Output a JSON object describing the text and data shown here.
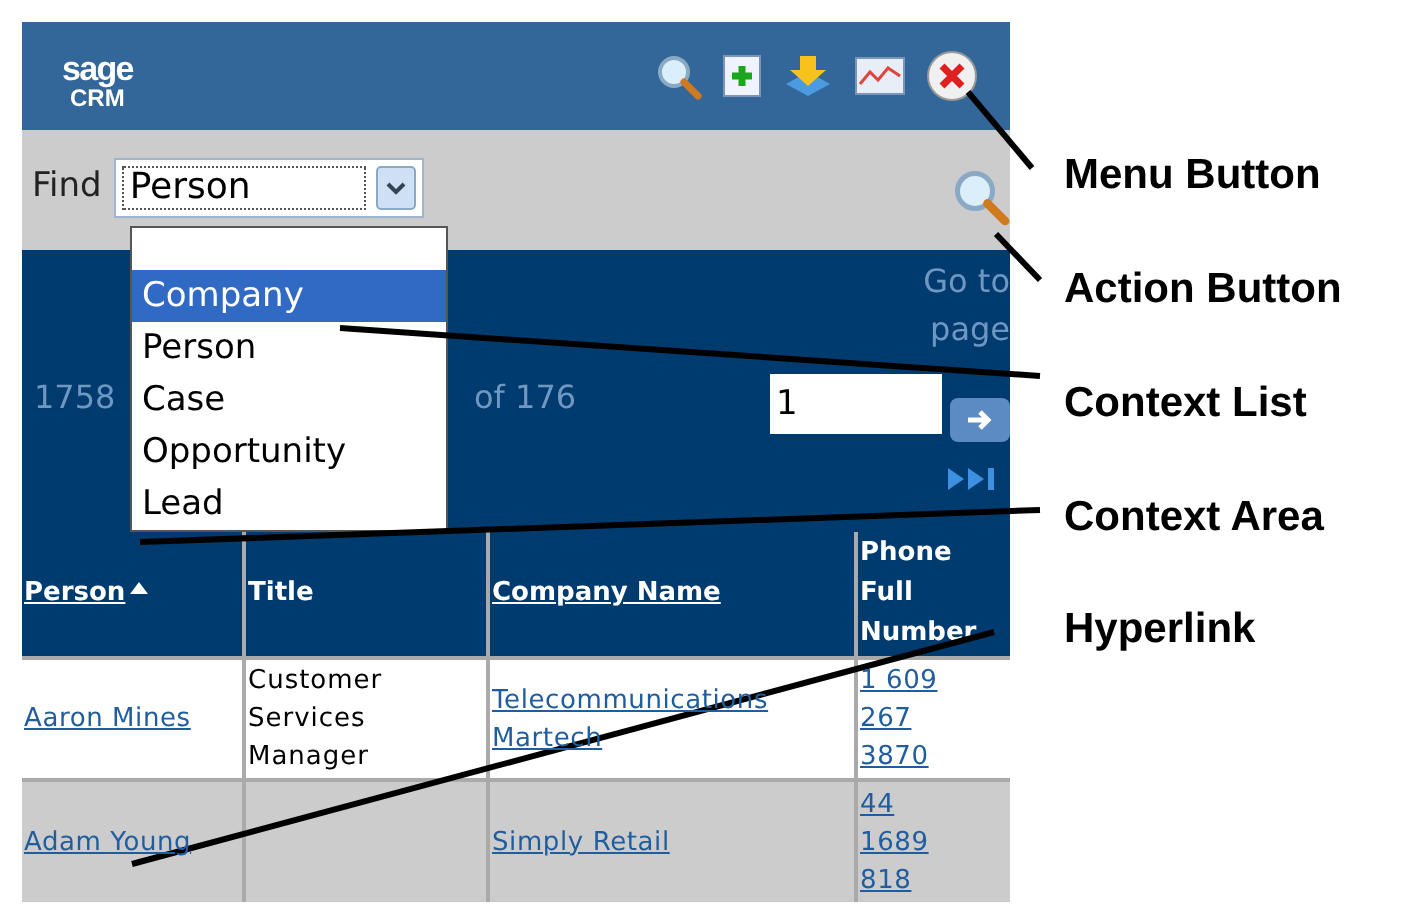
{
  "header": {
    "logo_top": "sage",
    "logo_bottom": "CRM"
  },
  "find_bar": {
    "label": "Find",
    "value": "Person"
  },
  "context_list": {
    "items": [
      {
        "label": "Company",
        "selected": true
      },
      {
        "label": "Person",
        "selected": false
      },
      {
        "label": "Case",
        "selected": false
      },
      {
        "label": "Opportunity",
        "selected": false
      },
      {
        "label": "Lead",
        "selected": false
      }
    ]
  },
  "context_area": {
    "count_text": "1758",
    "range_text": "of 176",
    "goto_label": "Go to page",
    "page_value": "1"
  },
  "table": {
    "columns": [
      {
        "label": "Person",
        "sorted": true,
        "link": true
      },
      {
        "label": "Title",
        "sorted": false,
        "link": false
      },
      {
        "label": "Company Name",
        "sorted": false,
        "link": true
      },
      {
        "label": "Phone Full Number",
        "sorted": false,
        "link": false
      }
    ],
    "rows": [
      {
        "cells": [
          {
            "kind": "link",
            "text": "Aaron Mines"
          },
          {
            "kind": "text",
            "text": "Customer Services Manager"
          },
          {
            "kind": "link",
            "text": "Telecommunications Martech"
          },
          {
            "kind": "link",
            "text": "1 609 267 3870"
          }
        ]
      },
      {
        "cells": [
          {
            "kind": "link",
            "text": "Adam Young"
          },
          {
            "kind": "empty"
          },
          {
            "kind": "link",
            "text": "Simply Retail"
          },
          {
            "kind": "link",
            "text": "44 1689 818"
          }
        ]
      }
    ]
  },
  "callouts": [
    {
      "label": "Menu Button"
    },
    {
      "label": "Action Button"
    },
    {
      "label": "Context List"
    },
    {
      "label": "Context Area"
    },
    {
      "label": "Hyperlink"
    }
  ]
}
